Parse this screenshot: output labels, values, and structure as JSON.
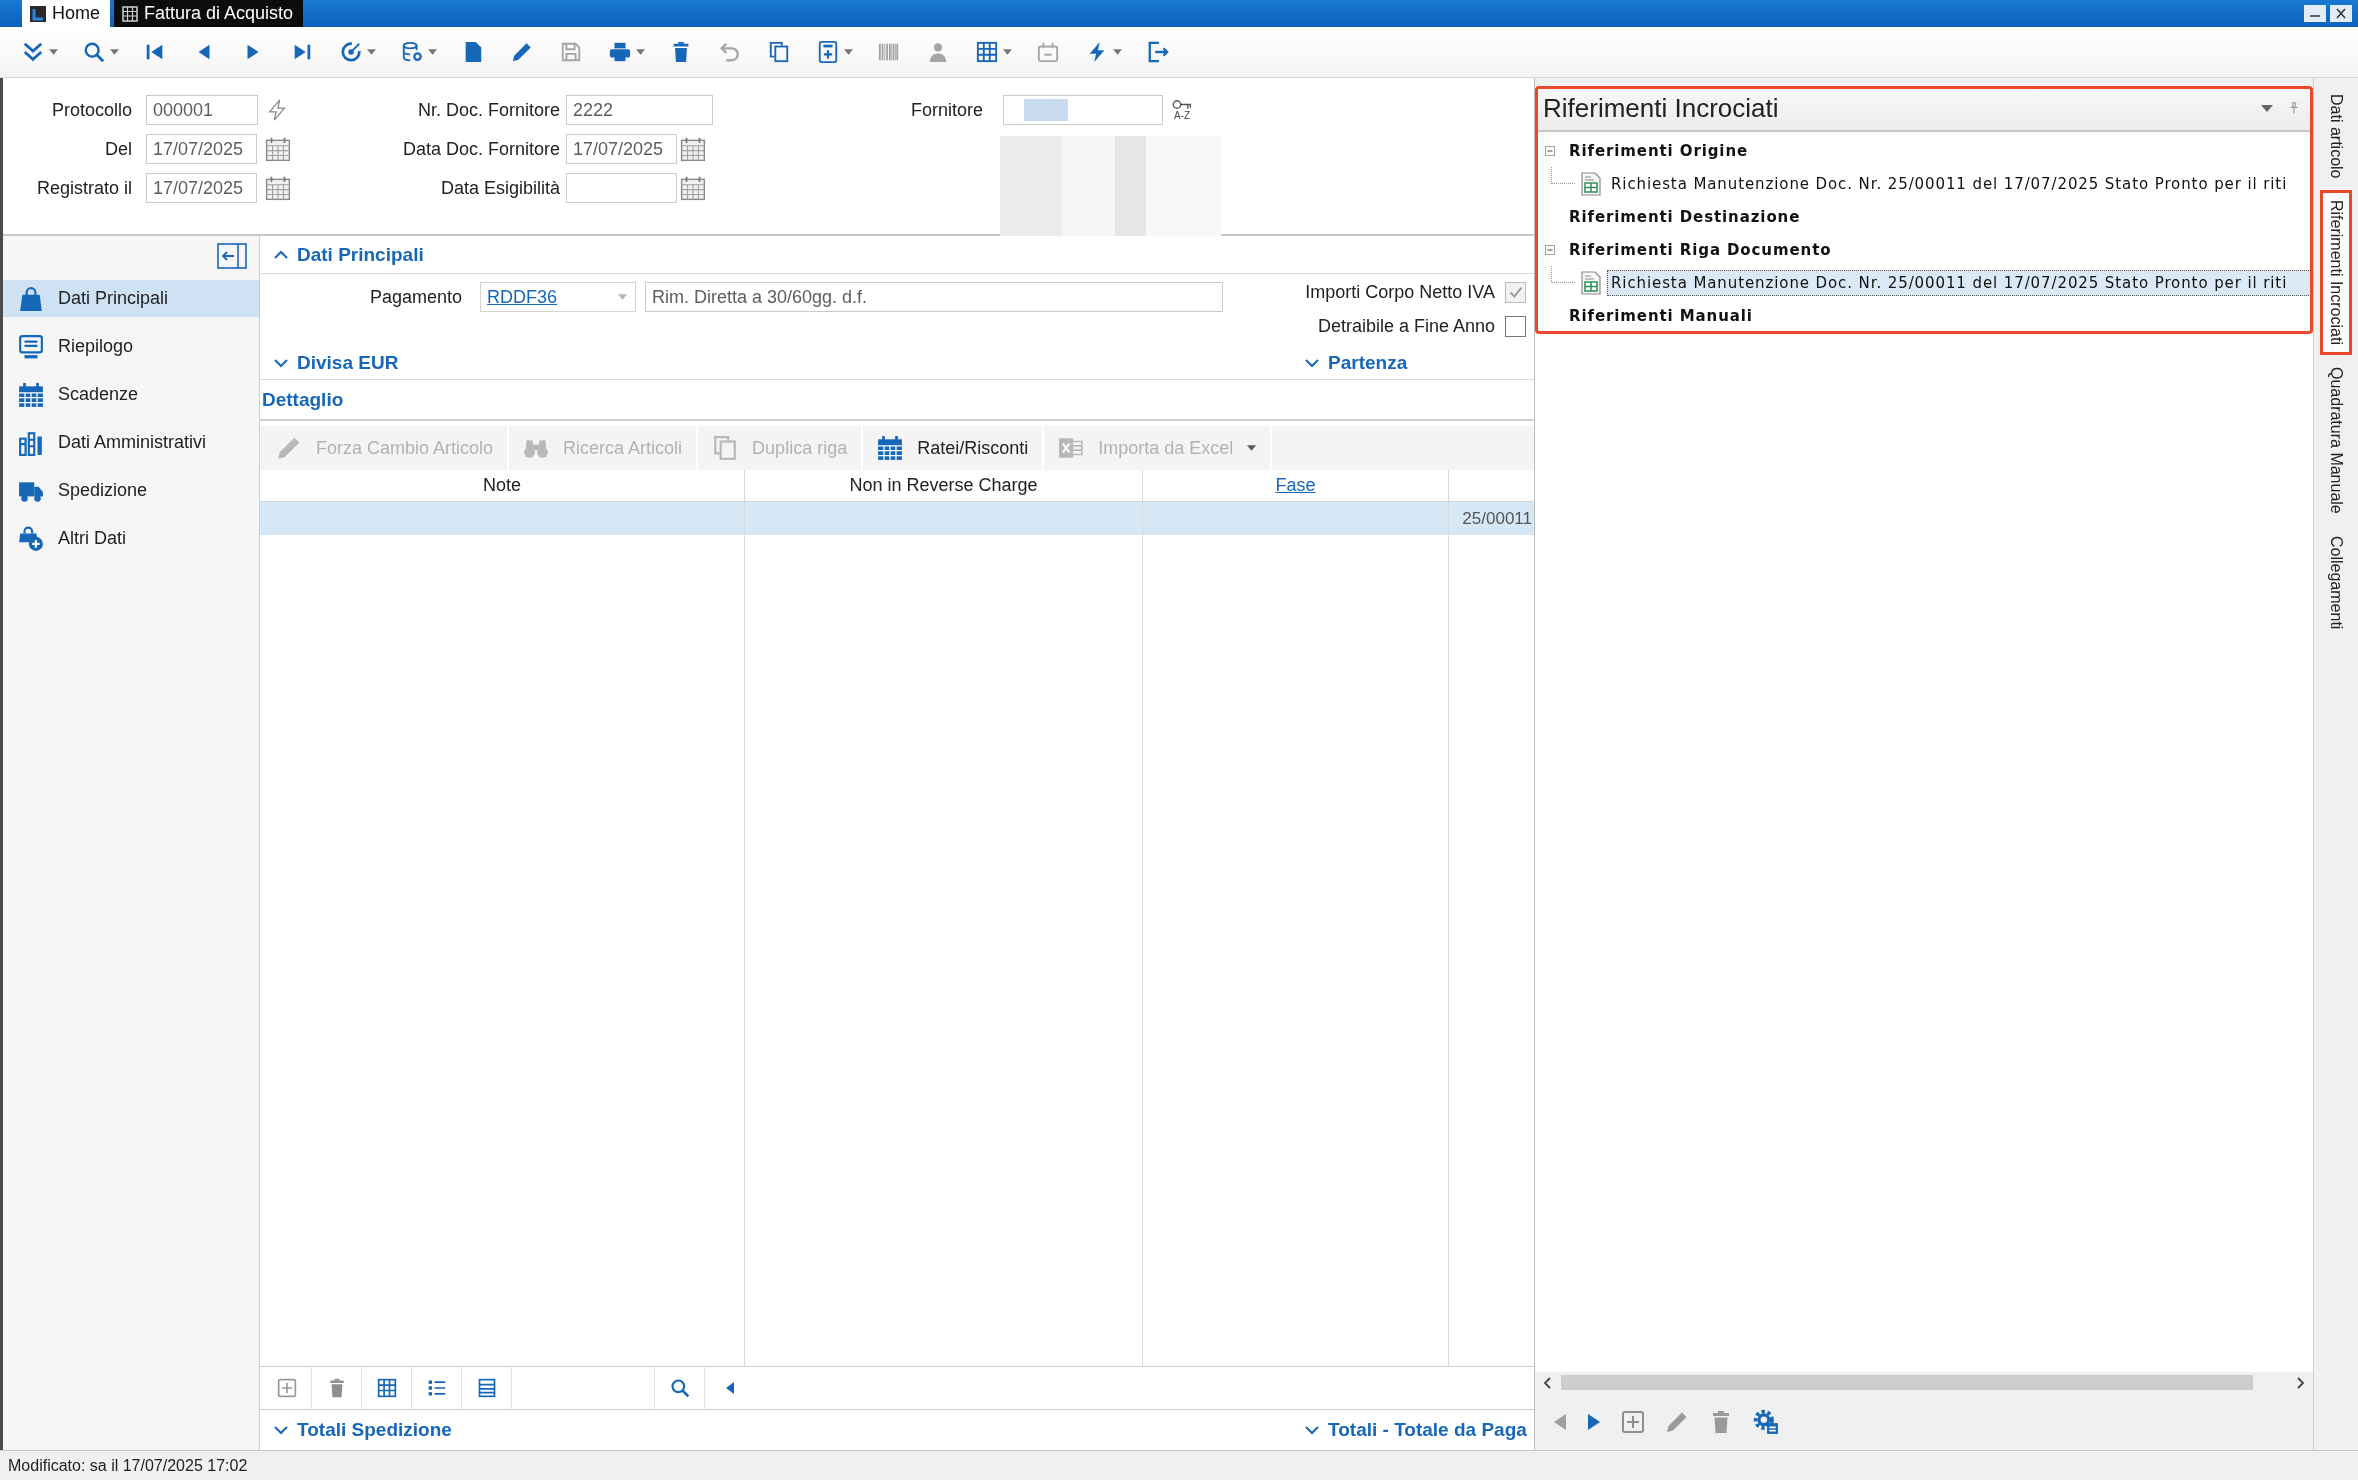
{
  "window": {
    "tabs": [
      {
        "label": "Home",
        "selected": false
      },
      {
        "label": "Fattura di Acquisto",
        "selected": true
      }
    ]
  },
  "toolbar": [
    {
      "dropdown": true,
      "disabled": false
    },
    {
      "dropdown": true,
      "disabled": false
    },
    {
      "dropdown": false,
      "disabled": false
    },
    {
      "dropdown": false,
      "disabled": false
    },
    {
      "dropdown": false,
      "disabled": false
    },
    {
      "dropdown": false,
      "disabled": false
    },
    {
      "dropdown": true,
      "disabled": false
    },
    {
      "dropdown": true,
      "disabled": false
    },
    {
      "dropdown": false,
      "disabled": false
    },
    {
      "dropdown": false,
      "disabled": false
    },
    {
      "dropdown": false,
      "disabled": true
    },
    {
      "dropdown": true,
      "disabled": false
    },
    {
      "dropdown": false,
      "disabled": false
    },
    {
      "dropdown": false,
      "disabled": true
    },
    {
      "dropdown": false,
      "disabled": false
    },
    {
      "dropdown": true,
      "disabled": false
    },
    {
      "dropdown": false,
      "disabled": true
    },
    {
      "dropdown": false,
      "disabled": true
    },
    {
      "dropdown": true,
      "disabled": false
    },
    {
      "dropdown": false,
      "disabled": true
    },
    {
      "dropdown": true,
      "disabled": false
    },
    {
      "dropdown": false,
      "disabled": false
    }
  ],
  "header": {
    "groups": [
      {
        "fields": [
          {
            "label": "Protocollo",
            "value": "000001",
            "kind": "auto_number"
          },
          {
            "label": "Del",
            "value": "17/07/2025",
            "kind": "date"
          },
          {
            "label": "Registrato il",
            "value": "17/07/2025",
            "kind": "date"
          }
        ]
      },
      {
        "fields": [
          {
            "label": "Nr. Doc. Fornitore",
            "value": "2222",
            "kind": "text"
          },
          {
            "label": "Data Doc. Fornitore",
            "value": "17/07/2025",
            "kind": "date"
          },
          {
            "label": "Data Esigibilità",
            "kind": "date"
          }
        ]
      },
      {
        "fields": [
          {
            "label": "Fornitore",
            "kind": "lookup",
            "lookup_caption": "A-Z",
            "redacted": true
          }
        ]
      }
    ]
  },
  "sidebar": {
    "items": [
      {
        "label": "Dati Principali",
        "selected": true
      },
      {
        "label": "Riepilogo",
        "selected": false
      },
      {
        "label": "Scadenze",
        "selected": false
      },
      {
        "label": "Dati Amministrativi",
        "selected": false
      },
      {
        "label": "Spedizione",
        "selected": false
      },
      {
        "label": "Altri Dati",
        "selected": false
      }
    ]
  },
  "dati_principali": {
    "title": "Dati Principali",
    "expanded": true,
    "payment": {
      "label": "Pagamento",
      "code": "RDDF36",
      "description": "Rim. Diretta a 30/60gg. d.f."
    },
    "options": [
      {
        "label": "Importi Corpo Netto IVA",
        "checked": true,
        "disabled": true
      },
      {
        "label": "Detraibile a Fine Anno",
        "checked": false,
        "disabled": false
      }
    ]
  },
  "middle_sections": [
    {
      "title": "Divisa EUR",
      "expanded": false
    },
    {
      "title": "Partenza",
      "expanded": false
    }
  ],
  "dettaglio": {
    "title": "Dettaglio",
    "toolbar": [
      {
        "label": "Forza Cambio Articolo",
        "disabled": true,
        "dropdown": false
      },
      {
        "label": "Ricerca Articoli",
        "disabled": true,
        "dropdown": false
      },
      {
        "label": "Duplica riga",
        "disabled": true,
        "dropdown": false
      },
      {
        "label": "Ratei/Risconti",
        "disabled": false,
        "dropdown": false
      },
      {
        "label": "Importa da Excel",
        "disabled": true,
        "dropdown": true
      }
    ],
    "columns": [
      {
        "label": "Note",
        "kind": "text"
      },
      {
        "label": "Non in Reverse Charge",
        "kind": "text"
      },
      {
        "label": "Fase",
        "kind": "link"
      },
      {
        "kind": "blank"
      }
    ],
    "rows": [
      {
        "selected": true,
        "column_4": "25/00011"
      }
    ]
  },
  "bottom_sections": [
    {
      "title": "Totali Spedizione",
      "expanded": false
    },
    {
      "title": "Totali - Totale da Paga",
      "expanded": false
    }
  ],
  "cross_references": {
    "title": "Riferimenti Incrociati",
    "highlighted": true,
    "tree": [
      {
        "label": "Riferimenti Origine",
        "expanded": true,
        "selected": false,
        "children": [
          {
            "label": "Richiesta Manutenzione Doc. Nr. 25/00011 del 17/07/2025 Stato Pronto per il riti",
            "selected": false
          }
        ]
      },
      {
        "label": "Riferimenti Destinazione",
        "selected": false
      },
      {
        "label": "Riferimenti Riga Documento",
        "expanded": true,
        "selected": false,
        "children": [
          {
            "label": "Richiesta Manutenzione Doc. Nr. 25/00011 del 17/07/2025 Stato Pronto per il riti",
            "selected": true
          }
        ]
      },
      {
        "label": "Riferimenti Manuali",
        "selected": false
      }
    ]
  },
  "side_tabs": [
    {
      "label": "Dati articolo",
      "selected": false,
      "highlighted": false
    },
    {
      "label": "Riferimenti Incrociati",
      "selected": true,
      "highlighted": true
    },
    {
      "label": "Quadratura Manuale",
      "selected": false,
      "highlighted": false
    },
    {
      "label": "Collegamenti",
      "selected": false,
      "highlighted": false
    }
  ],
  "status_bar": {
    "text": "Modificato: sa il 17/07/2025 17:02"
  }
}
